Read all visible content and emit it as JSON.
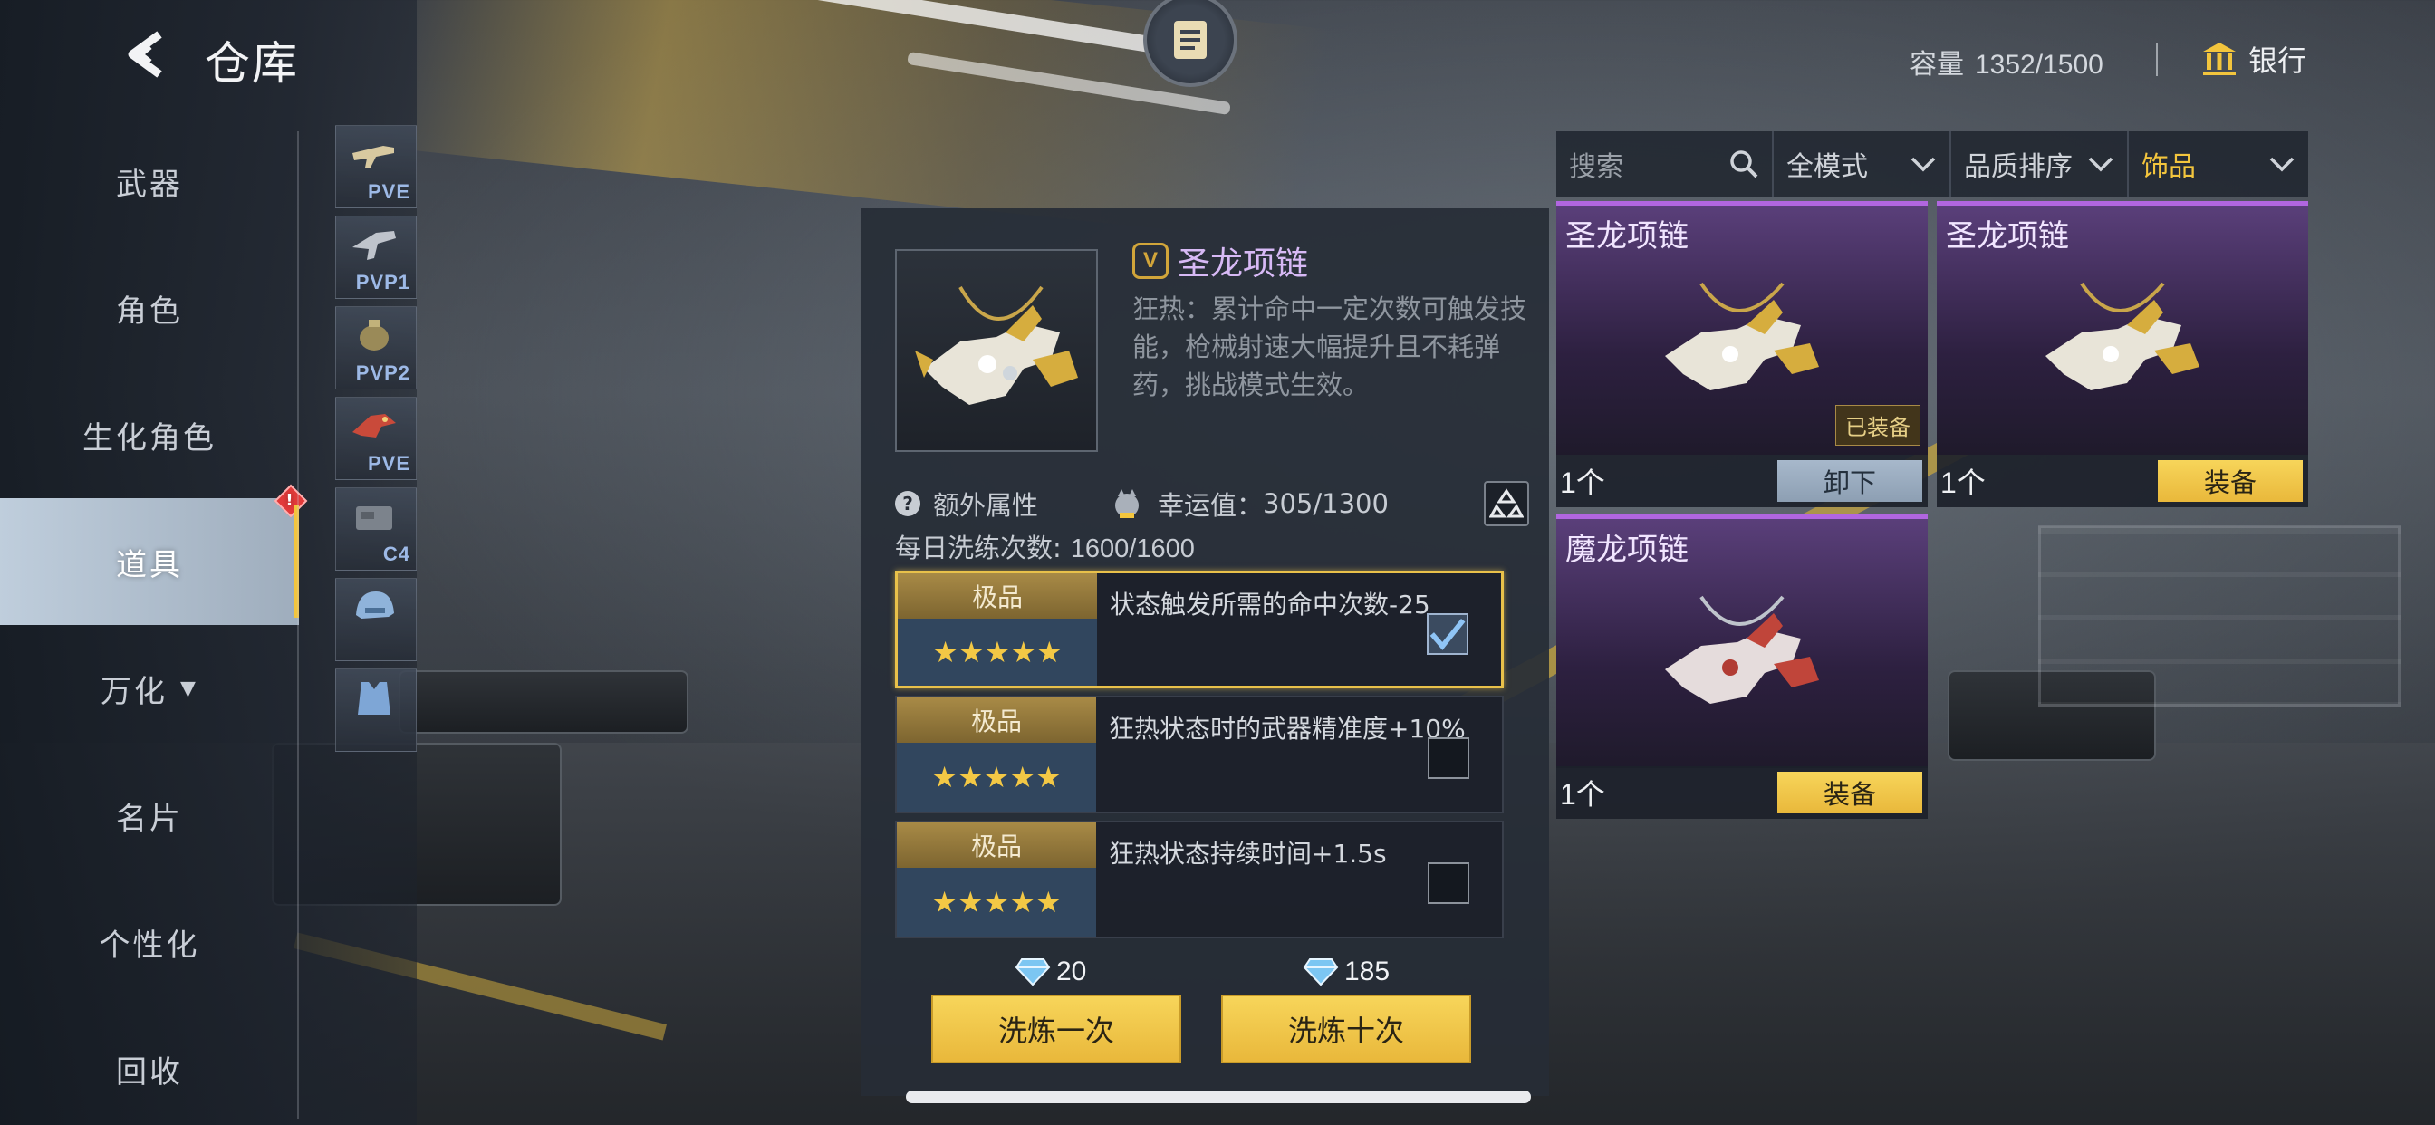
{
  "header": {
    "title": "仓库"
  },
  "topbar": {
    "capacity_label": "容量",
    "capacity_value": "1352/1500",
    "bank_label": "银行"
  },
  "nav": {
    "items": [
      {
        "label": "武器"
      },
      {
        "label": "角色"
      },
      {
        "label": "生化角色"
      },
      {
        "label": "道具",
        "active": true,
        "badge": "!"
      },
      {
        "label": "万化",
        "caret": "▼"
      },
      {
        "label": "名片"
      },
      {
        "label": "个性化"
      },
      {
        "label": "回收"
      }
    ]
  },
  "subnav": {
    "items": [
      {
        "tag": "PVE",
        "icon": "gun-icon"
      },
      {
        "tag": "PVP1",
        "icon": "gun-icon"
      },
      {
        "tag": "PVP2",
        "icon": "grenade-icon"
      },
      {
        "tag": "PVE",
        "icon": "dragon-icon"
      },
      {
        "tag": "C4",
        "icon": "c4-icon"
      },
      {
        "tag": "",
        "icon": "helmet-icon"
      },
      {
        "tag": "",
        "icon": "vest-icon"
      }
    ]
  },
  "detail": {
    "name": "圣龙项链",
    "vip_badge": "V",
    "description": "狂热：累计命中一定次数可触发技能，枪械射速大幅提升且不耗弹药，挑战模式生效。",
    "extra_attr_label": "额外属性",
    "luck_label": "幸运值：",
    "luck_value": "305/1300",
    "daily_label": "每日洗练次数:",
    "daily_value": "1600/1600",
    "rolls": [
      {
        "grade": "极品",
        "stars": "★★★★★",
        "text": "状态触发所需的命中次数-25",
        "checked": true
      },
      {
        "grade": "极品",
        "stars": "★★★★★",
        "text": "狂热状态时的武器精准度+10%",
        "checked": false
      },
      {
        "grade": "极品",
        "stars": "★★★★★",
        "text": "狂热状态持续时间+1.5s",
        "checked": false
      }
    ],
    "cost_once": "20",
    "cost_ten": "185",
    "btn_once": "洗炼一次",
    "btn_ten": "洗炼十次"
  },
  "filters": {
    "search_placeholder": "搜索",
    "mode": "全模式",
    "sort": "品质排序",
    "category": "饰品"
  },
  "inventory": [
    {
      "name": "圣龙项链",
      "qty": "1个",
      "equipped_tag": "已装备",
      "button": "卸下"
    },
    {
      "name": "圣龙项链",
      "qty": "1个",
      "equipped_tag": "",
      "button": "装备"
    },
    {
      "name": "魔龙项链",
      "qty": "1个",
      "equipped_tag": "",
      "button": "装备"
    }
  ],
  "colors": {
    "accent": "#f3c53d",
    "epic_purple": "#b166e0",
    "button_yellow": "#f7d55a"
  }
}
